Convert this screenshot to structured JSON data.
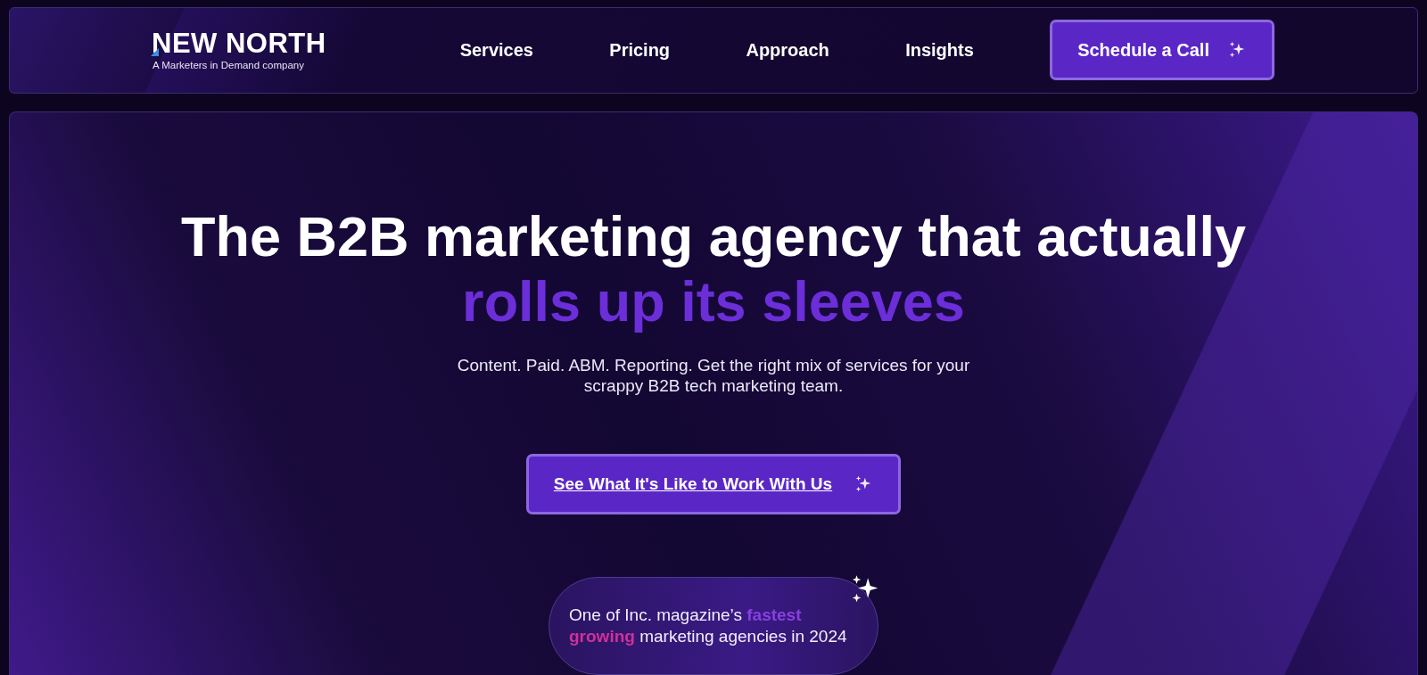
{
  "header": {
    "logo": "NEW NORTH",
    "tagline": "A Marketers in Demand company",
    "nav": [
      {
        "label": "Services",
        "kind": "link"
      },
      {
        "label": "Pricing",
        "kind": "link"
      },
      {
        "label": "Approach",
        "kind": "link"
      },
      {
        "label": "Insights",
        "kind": "link"
      },
      {
        "label": "Schedule a Call",
        "kind": "cta"
      }
    ]
  },
  "hero": {
    "headline": "The B2B marketing agency that actually",
    "headline_accent": "rolls up its sleeves",
    "subtitle": "Content. Paid. ABM. Reporting. Get the right mix of services for your scrappy B2B tech marketing team.",
    "cta": "See What It's Like to Work With Us",
    "badge": [
      {
        "text": "One of Inc. magazine’s ",
        "kind": "plain"
      },
      {
        "text": "fastest",
        "kind": "purple"
      },
      {
        "text": " growing",
        "kind": "magenta"
      },
      {
        "text": " marketing agencies in 2024",
        "kind": "plain"
      }
    ]
  }
}
